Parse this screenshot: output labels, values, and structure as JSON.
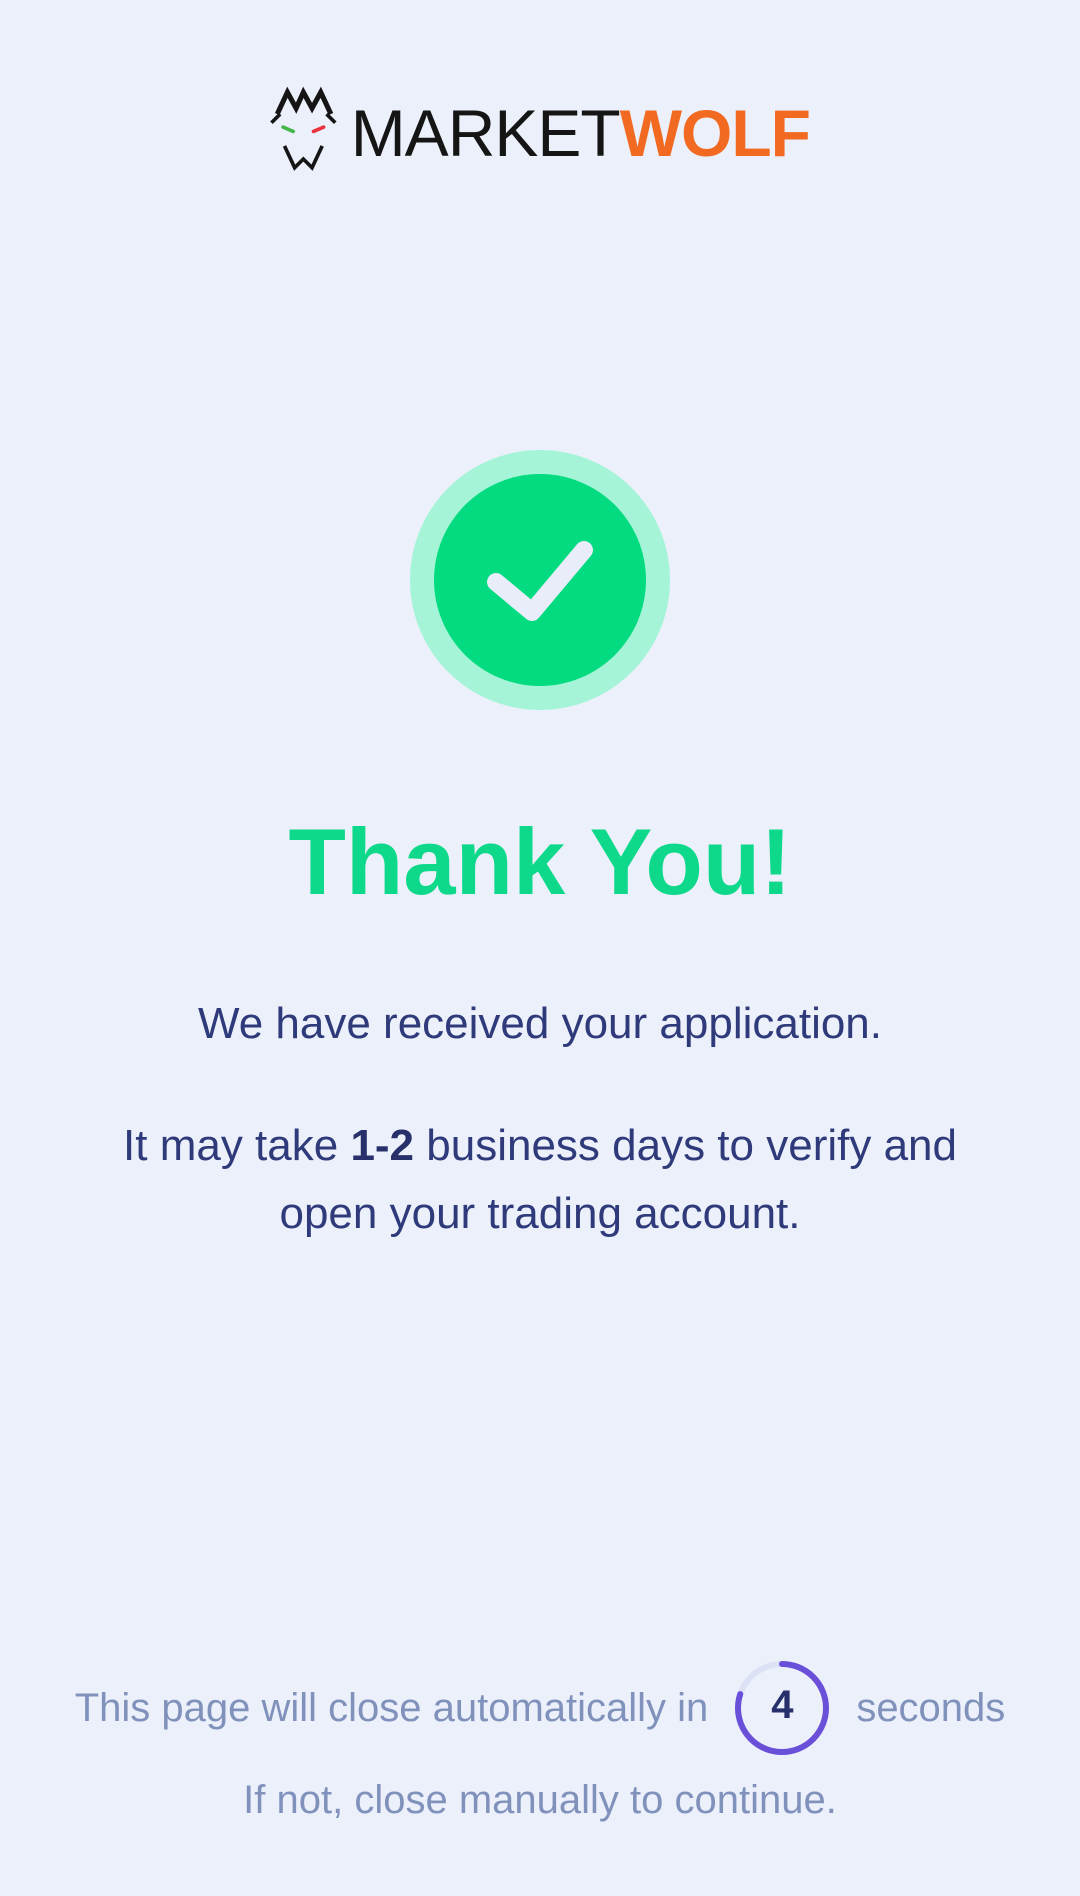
{
  "brand": {
    "name_part1": "MARKET",
    "name_part2": "WOLF",
    "logo_icon": "wolf-head-icon",
    "primary_text_color": "#151515",
    "accent_color": "#f26a21"
  },
  "status": {
    "icon": "checkmark-icon",
    "ring_color": "#a5f4d7",
    "fill_color": "#02db80",
    "title": "Thank You!",
    "title_color": "#0ed98a"
  },
  "message": {
    "line1": "We have received your application.",
    "line2_prefix": "It may take ",
    "line2_bold": "1-2",
    "line2_suffix": " business days to verify and open your trading account.",
    "text_color": "#2f3a7a"
  },
  "countdown": {
    "prefix": "This page will close automatically in",
    "value": "4",
    "suffix": "seconds",
    "progress_fraction": 0.8,
    "ring_color": "#6a4fd8",
    "track_color": "#dde1f5"
  },
  "footer": {
    "note": "If not, close manually to continue."
  },
  "background_color": "#ecf0fb"
}
